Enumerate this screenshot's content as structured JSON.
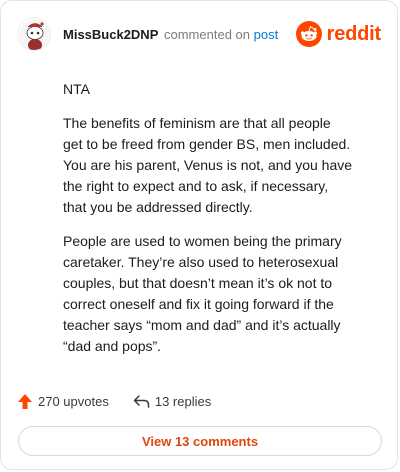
{
  "comment": {
    "username": "MissBuck2DNP",
    "action": "commented on",
    "target": "post",
    "paragraphs": [
      "NTA",
      "The benefits of feminism are that all people get to be freed from gender BS, men included. You are his parent, Venus is not, and you have the right to expect and to ask, if necessary, that you be addressed directly.",
      "People are used to women being the primary caretaker. They’re also used to heterosexual couples, but that doesn’t mean it’s ok not to correct oneself and fix it going forward if the teacher says “mom and dad” and it’s actually “dad and pops”."
    ]
  },
  "brand": {
    "name": "reddit",
    "icon": "reddit-logo-icon",
    "color": "#ff4500"
  },
  "stats": {
    "upvotes_label": "270 upvotes",
    "upvote_icon": "upvote-arrow-icon",
    "upvote_color": "#ff4500",
    "replies_label": "13 replies",
    "reply_icon": "reply-arrow-icon"
  },
  "actions": {
    "view_comments_label": "View 13 comments"
  }
}
